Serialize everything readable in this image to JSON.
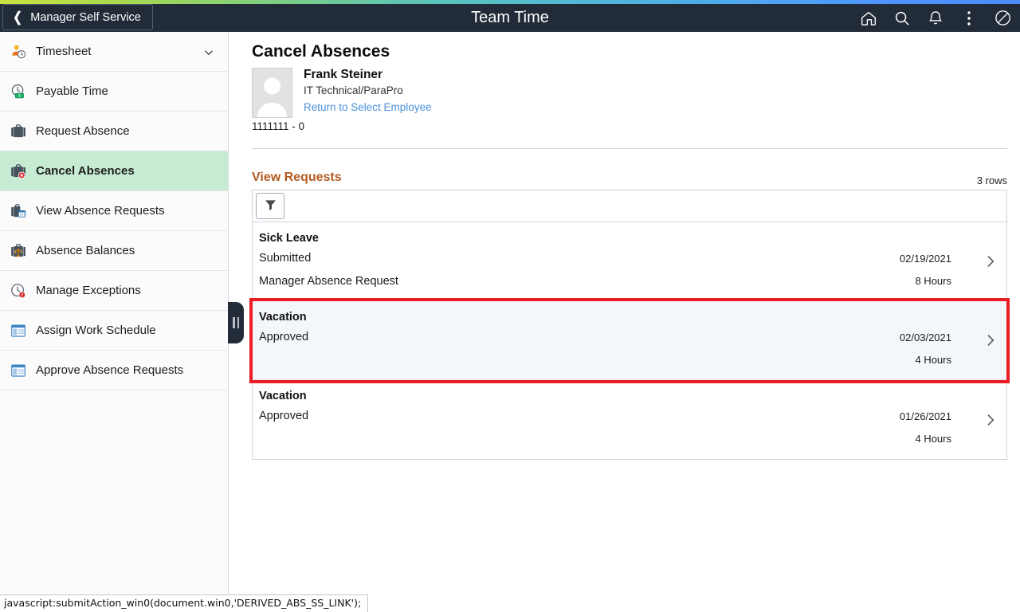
{
  "theme": {
    "header_bg": "#222b38",
    "accent_orange": "#b35b1f",
    "selected_nav_bg": "#c7ebd2",
    "highlight_border": "#ec1c24",
    "highlight_row_bg": "#f3f6fa",
    "link_blue": "#4a90d9",
    "gradient_from": "#cbe23f",
    "gradient_to": "#4d94ff"
  },
  "header": {
    "back_label": "Manager Self Service",
    "back_icon": "chevron-left-icon",
    "title": "Team Time",
    "icons": [
      {
        "name": "home-icon",
        "label": "Home"
      },
      {
        "name": "search-icon",
        "label": "Search"
      },
      {
        "name": "notifications-bell-icon",
        "label": "Notifications"
      },
      {
        "name": "actions-kebab-icon",
        "label": "Actions"
      },
      {
        "name": "navbar-icon",
        "label": "NavBar"
      }
    ]
  },
  "sidebar": {
    "collapse_handle": "pause-bars-handle",
    "items": [
      {
        "label": "Timesheet",
        "icon": "person-clock-icon",
        "selected": false,
        "expandable": true
      },
      {
        "label": "Payable Time",
        "icon": "clock-money-icon",
        "selected": false,
        "expandable": false
      },
      {
        "label": "Request Absence",
        "icon": "briefcase-icon",
        "selected": false,
        "expandable": false
      },
      {
        "label": "Cancel Absences",
        "icon": "briefcase-cancel-icon",
        "selected": true,
        "expandable": false
      },
      {
        "label": "View Absence Requests",
        "icon": "briefcase-calendar-icon",
        "selected": false,
        "expandable": false
      },
      {
        "label": "Absence Balances",
        "icon": "briefcase-scale-icon",
        "selected": false,
        "expandable": false
      },
      {
        "label": "Manage Exceptions",
        "icon": "clock-alert-icon",
        "selected": false,
        "expandable": false
      },
      {
        "label": "Assign Work Schedule",
        "icon": "window-panel-icon",
        "selected": false,
        "expandable": false
      },
      {
        "label": "Approve Absence Requests",
        "icon": "window-panel-icon",
        "selected": false,
        "expandable": false
      }
    ]
  },
  "main": {
    "page_title": "Cancel Absences",
    "employee": {
      "avatar_icon": "user-placeholder-avatar",
      "name": "Frank Steiner",
      "role": "IT Technical/ParaPro",
      "return_link": "Return to Select Employee",
      "employee_id": "1111111 - 0"
    },
    "section": {
      "title": "View Requests",
      "rows_count": "3 rows",
      "filter_icon": "funnel-filter-icon"
    },
    "requests": [
      {
        "type": "Sick Leave",
        "status": "Submitted",
        "source": "Manager Absence Request",
        "date": "02/19/2021",
        "hours": "8 Hours",
        "chevron": "chevron-right-icon",
        "highlighted": false
      },
      {
        "type": "Vacation",
        "status": "Approved",
        "source": "",
        "date": "02/03/2021",
        "hours": "4 Hours",
        "chevron": "chevron-right-icon",
        "highlighted": true
      },
      {
        "type": "Vacation",
        "status": "Approved",
        "source": "",
        "date": "01/26/2021",
        "hours": "4 Hours",
        "chevron": "chevron-right-icon",
        "highlighted": false
      }
    ]
  },
  "status_bar": {
    "text": "javascript:submitAction_win0(document.win0,'DERIVED_ABS_SS_LINK');"
  }
}
